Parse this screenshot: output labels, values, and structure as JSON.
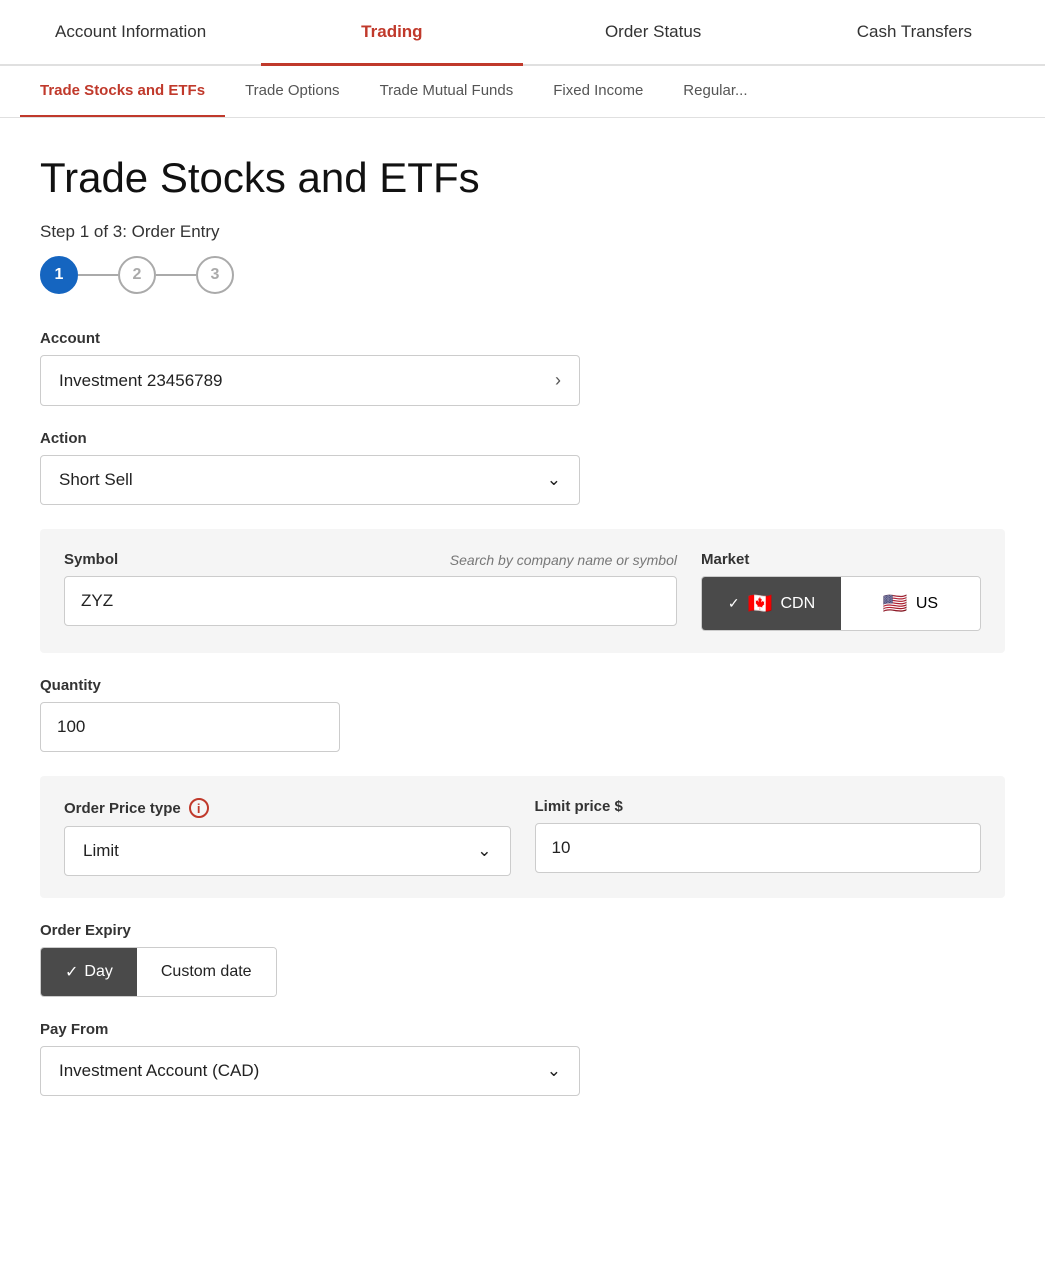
{
  "topNav": {
    "items": [
      {
        "label": "Account Information",
        "active": false
      },
      {
        "label": "Trading",
        "active": true
      },
      {
        "label": "Order Status",
        "active": false
      },
      {
        "label": "Cash Transfers",
        "active": false
      }
    ]
  },
  "subNav": {
    "items": [
      {
        "label": "Trade Stocks and ETFs",
        "active": true
      },
      {
        "label": "Trade Options",
        "active": false
      },
      {
        "label": "Trade Mutual Funds",
        "active": false
      },
      {
        "label": "Fixed Income",
        "active": false
      },
      {
        "label": "Regular...",
        "active": false
      }
    ]
  },
  "page": {
    "title": "Trade Stocks and ETFs",
    "stepLabel": "Step 1 of 3: Order Entry",
    "steps": [
      "1",
      "2",
      "3"
    ]
  },
  "form": {
    "accountLabel": "Account",
    "accountValue": "Investment 23456789",
    "actionLabel": "Action",
    "actionValue": "Short Sell",
    "symbolLabel": "Symbol",
    "symbolHint": "Search by company name or symbol",
    "symbolValue": "ZYZ",
    "marketLabel": "Market",
    "marketOptions": [
      {
        "label": "CDN",
        "flag": "🇨🇦",
        "active": true
      },
      {
        "label": "US",
        "flag": "🇺🇸",
        "active": false
      }
    ],
    "quantityLabel": "Quantity",
    "quantityValue": "100",
    "orderPriceLabel": "Order Price type",
    "orderPriceValue": "Limit",
    "limitPriceLabel": "Limit price $",
    "limitPriceValue": "10",
    "orderExpiryLabel": "Order Expiry",
    "expiryOptions": [
      {
        "label": "Day",
        "active": true
      },
      {
        "label": "Custom date",
        "active": false
      }
    ],
    "payFromLabel": "Pay From",
    "payFromValue": "Investment Account (CAD)"
  }
}
